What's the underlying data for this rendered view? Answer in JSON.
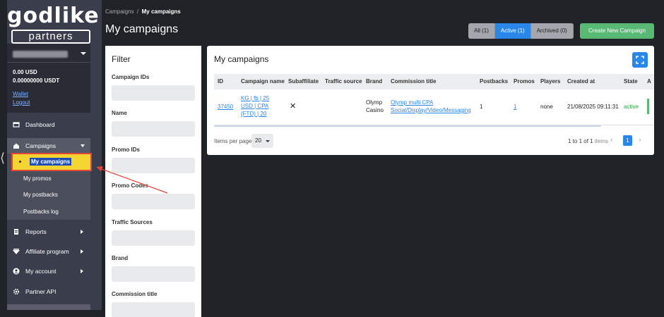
{
  "logo": {
    "top": "godlike",
    "bottom": "partners"
  },
  "account": {
    "balance_usd": "0.00  USD",
    "balance_usdt": "0.00000000  USDT",
    "wallet_link": "Wallet",
    "logout_link": "Logout"
  },
  "sidebar": {
    "dashboard": "Dashboard",
    "campaigns": "Campaigns",
    "sub": {
      "my_campaigns": "My campaigns",
      "my_promos": "My promos",
      "my_postbacks": "My postbacks",
      "postbacks_log": "Postbacks log"
    },
    "reports": "Reports",
    "affiliate_program": "Affiliate program",
    "my_account": "My account",
    "partner_api": "Partner API"
  },
  "breadcrumb": {
    "root": "Campaigns",
    "sep": "/",
    "current": "My campaigns"
  },
  "page_title": "My campaigns",
  "status_filters": [
    "All (1)",
    "Active (1)",
    "Archived (0)"
  ],
  "create_button": "Create New Campaign",
  "filter": {
    "title": "Filter",
    "fields": [
      "Campaign IDs",
      "Name",
      "Promo IDs",
      "Promo Codes",
      "Traffic Sources",
      "Brand",
      "Commission title"
    ]
  },
  "table": {
    "title": "My campaigns",
    "headers": [
      "ID",
      "Campaign name",
      "Subaffiliate",
      "Traffic source",
      "Brand",
      "Commission title",
      "Postbacks",
      "Promos",
      "Players",
      "Created at",
      "State",
      "A"
    ],
    "row": {
      "id": "37450",
      "name_lines": [
        "KG | fb | 25",
        "USD | CPA",
        "(FTD) | 20"
      ],
      "subaffiliate": "✕",
      "traffic_source": "",
      "brand_lines": [
        "Olymp",
        "Casino"
      ],
      "commission_lines": [
        "Olymp multi CPA",
        "Social/Display/Video/Messaging"
      ],
      "postbacks": "1",
      "promos": "1",
      "players": "none",
      "created_at": "21/08/2025 09:11:31",
      "state": "active"
    },
    "per_page_label": "Items per page",
    "per_page_value": "20",
    "range_main": "1 to 1 of 1",
    "range_suffix": " items",
    "page": "1",
    "prev": "‹",
    "next": "›"
  },
  "colors": {
    "sidebar": "#3a3d4b",
    "accent_blue": "#2a86e8",
    "create_green": "#58b874",
    "highlight_yellow": "#f3d430",
    "annotation_red": "#e0463a"
  }
}
